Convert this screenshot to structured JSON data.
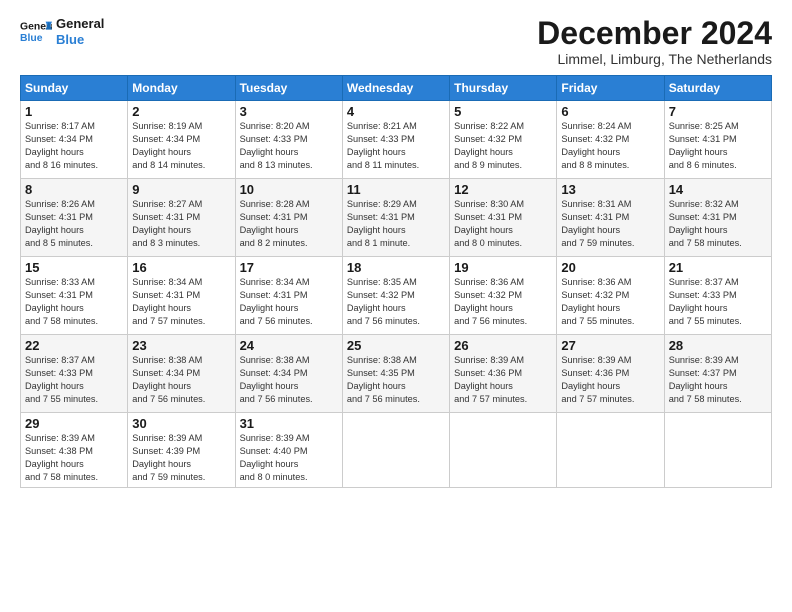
{
  "header": {
    "logo_line1": "General",
    "logo_line2": "Blue",
    "title": "December 2024",
    "location": "Limmel, Limburg, The Netherlands"
  },
  "days_of_week": [
    "Sunday",
    "Monday",
    "Tuesday",
    "Wednesday",
    "Thursday",
    "Friday",
    "Saturday"
  ],
  "weeks": [
    [
      {
        "day": "1",
        "sunrise": "8:17 AM",
        "sunset": "4:34 PM",
        "daylight": "8 hours and 16 minutes."
      },
      {
        "day": "2",
        "sunrise": "8:19 AM",
        "sunset": "4:34 PM",
        "daylight": "8 hours and 14 minutes."
      },
      {
        "day": "3",
        "sunrise": "8:20 AM",
        "sunset": "4:33 PM",
        "daylight": "8 hours and 13 minutes."
      },
      {
        "day": "4",
        "sunrise": "8:21 AM",
        "sunset": "4:33 PM",
        "daylight": "8 hours and 11 minutes."
      },
      {
        "day": "5",
        "sunrise": "8:22 AM",
        "sunset": "4:32 PM",
        "daylight": "8 hours and 9 minutes."
      },
      {
        "day": "6",
        "sunrise": "8:24 AM",
        "sunset": "4:32 PM",
        "daylight": "8 hours and 8 minutes."
      },
      {
        "day": "7",
        "sunrise": "8:25 AM",
        "sunset": "4:31 PM",
        "daylight": "8 hours and 6 minutes."
      }
    ],
    [
      {
        "day": "8",
        "sunrise": "8:26 AM",
        "sunset": "4:31 PM",
        "daylight": "8 hours and 5 minutes."
      },
      {
        "day": "9",
        "sunrise": "8:27 AM",
        "sunset": "4:31 PM",
        "daylight": "8 hours and 3 minutes."
      },
      {
        "day": "10",
        "sunrise": "8:28 AM",
        "sunset": "4:31 PM",
        "daylight": "8 hours and 2 minutes."
      },
      {
        "day": "11",
        "sunrise": "8:29 AM",
        "sunset": "4:31 PM",
        "daylight": "8 hours and 1 minute."
      },
      {
        "day": "12",
        "sunrise": "8:30 AM",
        "sunset": "4:31 PM",
        "daylight": "8 hours and 0 minutes."
      },
      {
        "day": "13",
        "sunrise": "8:31 AM",
        "sunset": "4:31 PM",
        "daylight": "7 hours and 59 minutes."
      },
      {
        "day": "14",
        "sunrise": "8:32 AM",
        "sunset": "4:31 PM",
        "daylight": "7 hours and 58 minutes."
      }
    ],
    [
      {
        "day": "15",
        "sunrise": "8:33 AM",
        "sunset": "4:31 PM",
        "daylight": "7 hours and 58 minutes."
      },
      {
        "day": "16",
        "sunrise": "8:34 AM",
        "sunset": "4:31 PM",
        "daylight": "7 hours and 57 minutes."
      },
      {
        "day": "17",
        "sunrise": "8:34 AM",
        "sunset": "4:31 PM",
        "daylight": "7 hours and 56 minutes."
      },
      {
        "day": "18",
        "sunrise": "8:35 AM",
        "sunset": "4:32 PM",
        "daylight": "7 hours and 56 minutes."
      },
      {
        "day": "19",
        "sunrise": "8:36 AM",
        "sunset": "4:32 PM",
        "daylight": "7 hours and 56 minutes."
      },
      {
        "day": "20",
        "sunrise": "8:36 AM",
        "sunset": "4:32 PM",
        "daylight": "7 hours and 55 minutes."
      },
      {
        "day": "21",
        "sunrise": "8:37 AM",
        "sunset": "4:33 PM",
        "daylight": "7 hours and 55 minutes."
      }
    ],
    [
      {
        "day": "22",
        "sunrise": "8:37 AM",
        "sunset": "4:33 PM",
        "daylight": "7 hours and 55 minutes."
      },
      {
        "day": "23",
        "sunrise": "8:38 AM",
        "sunset": "4:34 PM",
        "daylight": "7 hours and 56 minutes."
      },
      {
        "day": "24",
        "sunrise": "8:38 AM",
        "sunset": "4:34 PM",
        "daylight": "7 hours and 56 minutes."
      },
      {
        "day": "25",
        "sunrise": "8:38 AM",
        "sunset": "4:35 PM",
        "daylight": "7 hours and 56 minutes."
      },
      {
        "day": "26",
        "sunrise": "8:39 AM",
        "sunset": "4:36 PM",
        "daylight": "7 hours and 57 minutes."
      },
      {
        "day": "27",
        "sunrise": "8:39 AM",
        "sunset": "4:36 PM",
        "daylight": "7 hours and 57 minutes."
      },
      {
        "day": "28",
        "sunrise": "8:39 AM",
        "sunset": "4:37 PM",
        "daylight": "7 hours and 58 minutes."
      }
    ],
    [
      {
        "day": "29",
        "sunrise": "8:39 AM",
        "sunset": "4:38 PM",
        "daylight": "7 hours and 58 minutes."
      },
      {
        "day": "30",
        "sunrise": "8:39 AM",
        "sunset": "4:39 PM",
        "daylight": "7 hours and 59 minutes."
      },
      {
        "day": "31",
        "sunrise": "8:39 AM",
        "sunset": "4:40 PM",
        "daylight": "8 hours and 0 minutes."
      },
      null,
      null,
      null,
      null
    ]
  ]
}
